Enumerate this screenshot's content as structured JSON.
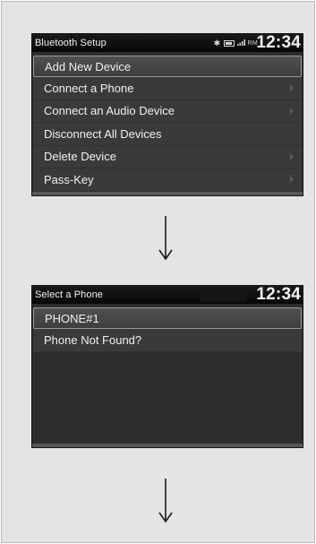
{
  "screen1": {
    "title": "Bluetooth Setup",
    "status_icons": "RM",
    "clock": "12:34",
    "menu_items": [
      {
        "label": "Add New Device",
        "selected": true,
        "has_arrow": false
      },
      {
        "label": "Connect a Phone",
        "selected": false,
        "has_arrow": true
      },
      {
        "label": "Connect an Audio Device",
        "selected": false,
        "has_arrow": true
      },
      {
        "label": "Disconnect All Devices",
        "selected": false,
        "has_arrow": false
      },
      {
        "label": "Delete Device",
        "selected": false,
        "has_arrow": true
      },
      {
        "label": "Pass-Key",
        "selected": false,
        "has_arrow": true
      }
    ]
  },
  "screen2": {
    "title": "Select a Phone",
    "clock": "12:34",
    "menu_items": [
      {
        "label": "PHONE#1",
        "selected": true
      },
      {
        "label": "Phone Not Found?",
        "selected": false
      }
    ]
  },
  "icons": [
    "bluetooth-icon",
    "battery-icon",
    "signal-icon",
    "down-arrow-icon"
  ]
}
